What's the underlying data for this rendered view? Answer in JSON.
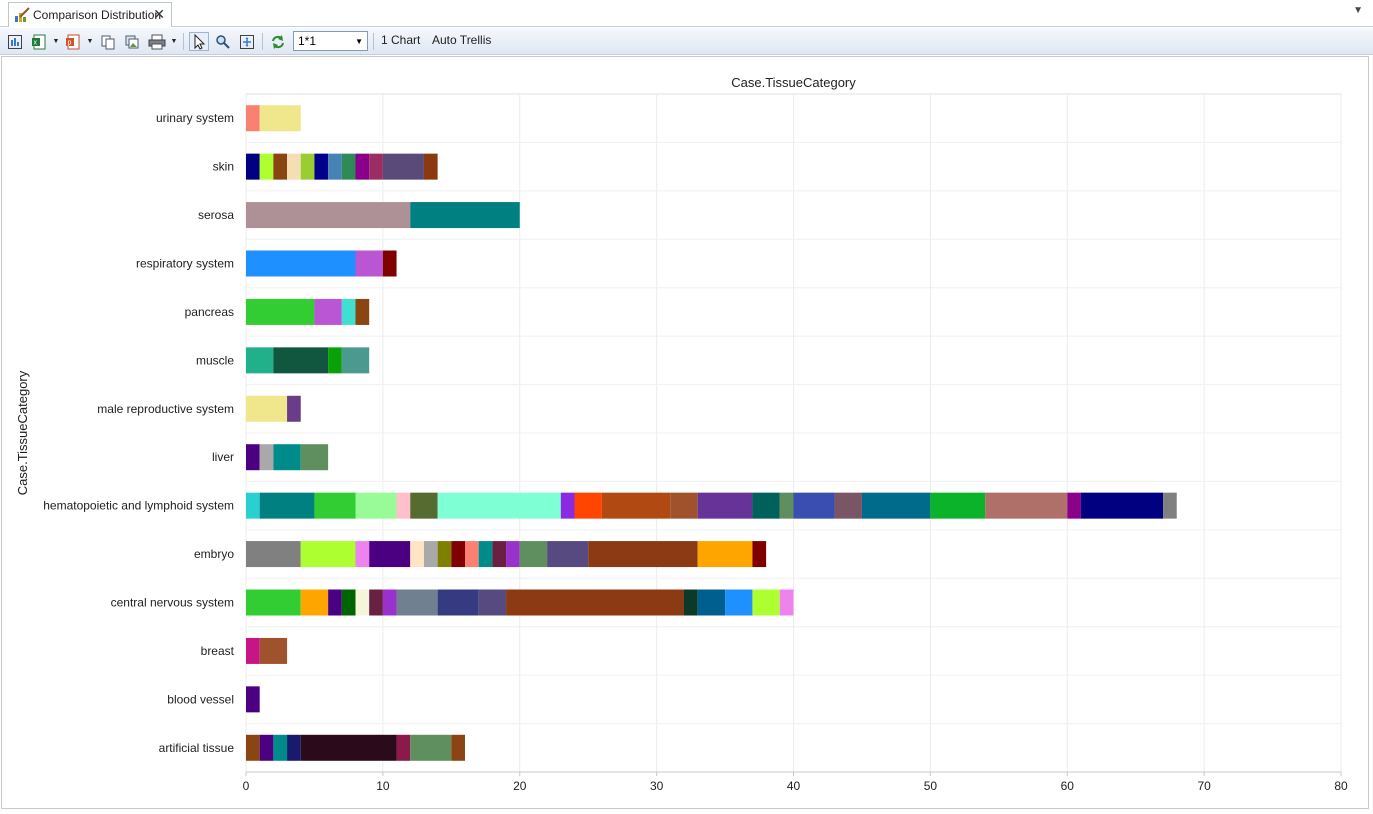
{
  "tab": {
    "title": "Comparison Distribution",
    "icon": "chart-pen-icon",
    "close_icon": "close-icon"
  },
  "toolbar": {
    "zoom_value": "1*1",
    "chart_count_label": "1 Chart",
    "auto_trellis_label": "Auto Trellis",
    "icons": [
      "fit-chart-icon",
      "excel-export-icon",
      "powerpoint-export-icon",
      "copy-icon",
      "copy-image-icon",
      "print-icon",
      "pointer-icon",
      "zoom-icon",
      "fit-to-window-icon",
      "refresh-icon"
    ]
  },
  "chart_data": {
    "type": "bar",
    "orientation": "horizontal",
    "stacked": true,
    "title": "Case.TissueCategory",
    "ylabel": "Case.TissueCategory",
    "xlabel": "",
    "xlim": [
      0,
      80
    ],
    "xticks": [
      0,
      10,
      20,
      30,
      40,
      50,
      60,
      70,
      80
    ],
    "grid": true,
    "categories": [
      "urinary system",
      "skin",
      "serosa",
      "respiratory system",
      "pancreas",
      "muscle",
      "male reproductive system",
      "liver",
      "hematopoietic and lymphoid system",
      "embryo",
      "central nervous system",
      "breast",
      "blood vessel",
      "artificial tissue"
    ],
    "stacks": [
      [
        [
          1,
          "#fa8072"
        ],
        [
          3,
          "#f0e68c"
        ]
      ],
      [
        [
          1,
          "#000080"
        ],
        [
          1,
          "#adff2f"
        ],
        [
          1,
          "#8b4513"
        ],
        [
          1,
          "#f5deb3"
        ],
        [
          1,
          "#9acd32"
        ],
        [
          1,
          "#00008b"
        ],
        [
          1,
          "#4682b4"
        ],
        [
          1,
          "#2e8b57"
        ],
        [
          1,
          "#8b008b"
        ],
        [
          1,
          "#9b2d62"
        ],
        [
          3,
          "#5a4a7a"
        ],
        [
          1,
          "#8b3a0f"
        ]
      ],
      [
        [
          12,
          "#ae9196"
        ],
        [
          8,
          "#008080"
        ]
      ],
      [
        [
          8,
          "#1e90ff"
        ],
        [
          2,
          "#ba55d3"
        ],
        [
          1,
          "#800000"
        ]
      ],
      [
        [
          5,
          "#32cd32"
        ],
        [
          2,
          "#ba55d3"
        ],
        [
          1,
          "#40e0d0"
        ],
        [
          1,
          "#8b4513"
        ]
      ],
      [
        [
          2,
          "#20b08a"
        ],
        [
          4,
          "#11563e"
        ],
        [
          1,
          "#0aa00a"
        ],
        [
          2,
          "#4a9a90"
        ]
      ],
      [
        [
          3,
          "#f0e68c"
        ],
        [
          1,
          "#6a3d8a"
        ]
      ],
      [
        [
          1,
          "#4b0082"
        ],
        [
          1,
          "#a9a9a9"
        ],
        [
          2,
          "#008b8b"
        ],
        [
          2,
          "#5f8f5f"
        ]
      ],
      [
        [
          1,
          "#28d0d0"
        ],
        [
          4,
          "#008080"
        ],
        [
          3,
          "#32cd32"
        ],
        [
          3,
          "#98fb98"
        ],
        [
          1,
          "#ffc0cb"
        ],
        [
          2,
          "#556b2f"
        ],
        [
          9,
          "#7fffd4"
        ],
        [
          1,
          "#8a2be2"
        ],
        [
          2,
          "#ff4500"
        ],
        [
          5,
          "#b04a12"
        ],
        [
          2,
          "#a0522d"
        ],
        [
          4,
          "#663399"
        ],
        [
          2,
          "#00605a"
        ],
        [
          1,
          "#5f8f5f"
        ],
        [
          3,
          "#3a4db0"
        ],
        [
          2,
          "#7a5565"
        ],
        [
          5,
          "#006b8a"
        ],
        [
          4,
          "#0bb32a"
        ],
        [
          6,
          "#b0706a"
        ],
        [
          1,
          "#8b008b"
        ],
        [
          6,
          "#000080"
        ],
        [
          1,
          "#808080"
        ]
      ],
      [
        [
          4,
          "#808080"
        ],
        [
          4,
          "#adff2f"
        ],
        [
          1,
          "#ee82ee"
        ],
        [
          3,
          "#4b0082"
        ],
        [
          1,
          "#ffe4c4"
        ],
        [
          1,
          "#a9a9a9"
        ],
        [
          1,
          "#808000"
        ],
        [
          1,
          "#800000"
        ],
        [
          1,
          "#fa8072"
        ],
        [
          1,
          "#008b8b"
        ],
        [
          1,
          "#6a2040"
        ],
        [
          1,
          "#9932cc"
        ],
        [
          2,
          "#5f8f5f"
        ],
        [
          3,
          "#574a80"
        ],
        [
          8,
          "#8b3a13"
        ],
        [
          4,
          "#ffa500"
        ],
        [
          1,
          "#800000"
        ]
      ],
      [
        [
          4,
          "#32cd32"
        ],
        [
          2,
          "#ffa500"
        ],
        [
          1,
          "#4b0082"
        ],
        [
          1,
          "#006400"
        ],
        [
          1,
          "#f5f5dc"
        ],
        [
          1,
          "#6a2040"
        ],
        [
          1,
          "#9932cc"
        ],
        [
          3,
          "#708090"
        ],
        [
          3,
          "#363a80"
        ],
        [
          2,
          "#574a80"
        ],
        [
          13,
          "#8b3a13"
        ],
        [
          1,
          "#0a3a2a"
        ],
        [
          2,
          "#005f8f"
        ],
        [
          2,
          "#1e90ff"
        ],
        [
          2,
          "#adff2f"
        ],
        [
          1,
          "#ee82ee"
        ]
      ],
      [
        [
          1,
          "#c71585"
        ],
        [
          2,
          "#a0522d"
        ]
      ],
      [
        [
          1,
          "#4b0082"
        ]
      ],
      [
        [
          1,
          "#8b4513"
        ],
        [
          1,
          "#4b0082"
        ],
        [
          1,
          "#008b8b"
        ],
        [
          1,
          "#191970"
        ],
        [
          7,
          "#2b0b1b"
        ],
        [
          1,
          "#8b1a4a"
        ],
        [
          3,
          "#5f8f5f"
        ],
        [
          1,
          "#8b4513"
        ]
      ]
    ]
  }
}
